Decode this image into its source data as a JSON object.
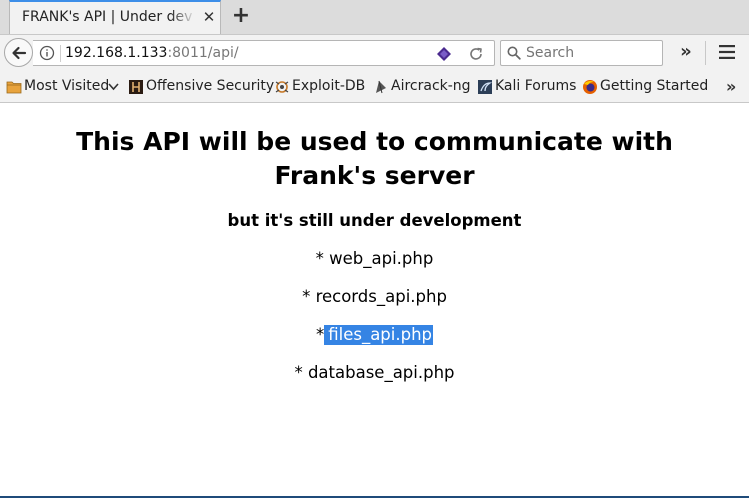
{
  "browser": {
    "tab_title": "FRANK's API | Under development",
    "url_host": "192.168.1.133",
    "url_rest": ":8011/api/",
    "search_placeholder": "Search",
    "colors": {
      "accent": "#3d8ee8",
      "selection": "#3584e4"
    }
  },
  "bookmarks": [
    {
      "label": "Most Visited",
      "icon": "folder-icon"
    },
    {
      "label": "Offensive Security",
      "icon": "offsec-icon"
    },
    {
      "label": "Exploit-DB",
      "icon": "exploitdb-icon"
    },
    {
      "label": "Aircrack-ng",
      "icon": "aircrack-icon"
    },
    {
      "label": "Kali Forums",
      "icon": "kali-icon"
    },
    {
      "label": "Getting Started",
      "icon": "firefox-icon"
    }
  ],
  "page": {
    "heading": "This API will be used to communicate with Frank's server",
    "subheading": "but it's still under development",
    "bullet": "*",
    "items": [
      "web_api.php",
      "records_api.php",
      "files_api.php",
      "database_api.php"
    ],
    "selected_item": "files_api.php"
  }
}
